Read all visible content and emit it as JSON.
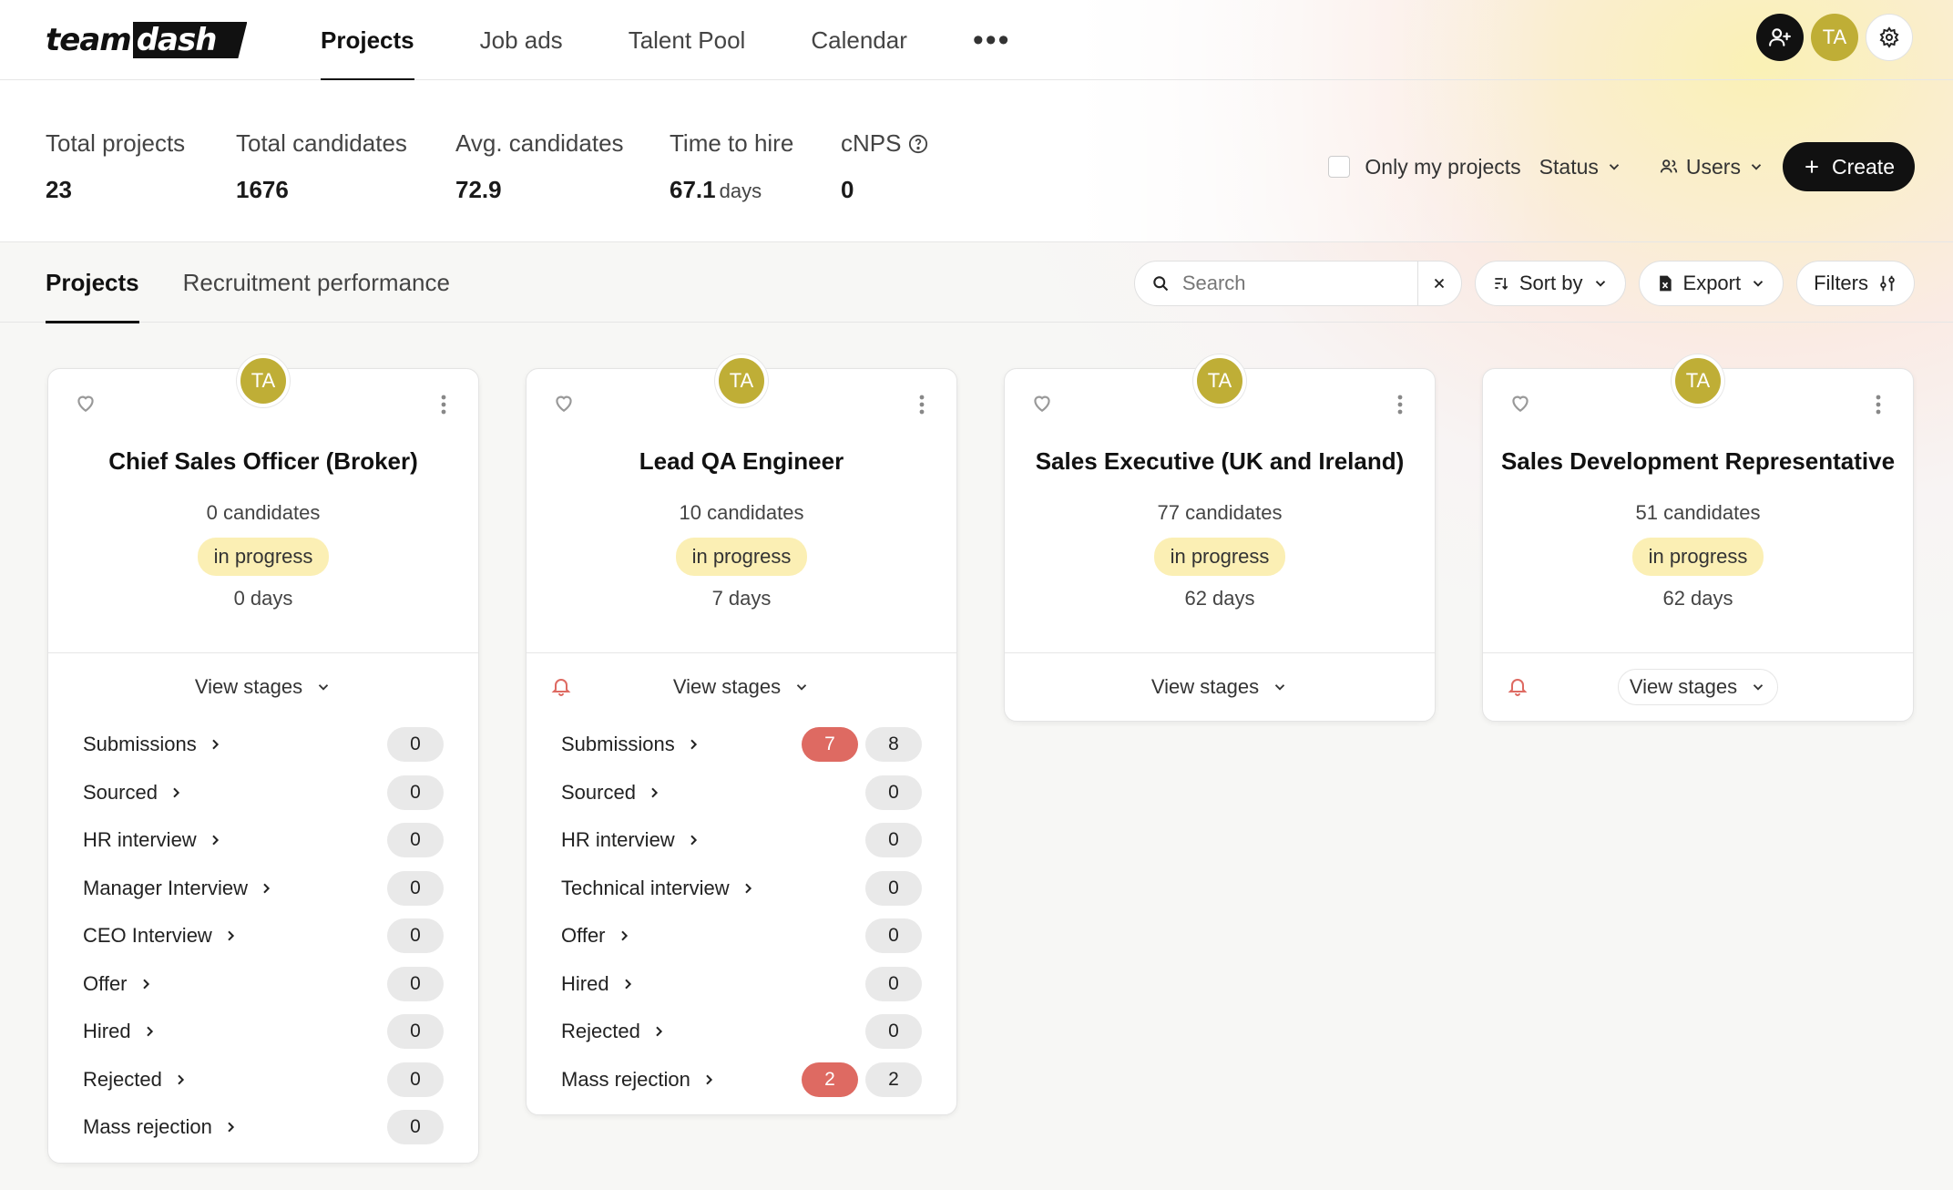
{
  "app": {
    "logo_left": "team",
    "logo_right": "dash"
  },
  "nav": [
    {
      "label": "Projects",
      "active": true
    },
    {
      "label": "Job ads",
      "active": false
    },
    {
      "label": "Talent Pool",
      "active": false
    },
    {
      "label": "Calendar",
      "active": false
    }
  ],
  "nav_more": "•••",
  "user": {
    "initials": "TA"
  },
  "stats": [
    {
      "label": "Total projects",
      "value": "23",
      "unit": ""
    },
    {
      "label": "Total candidates",
      "value": "1676",
      "unit": ""
    },
    {
      "label": "Avg. candidates",
      "value": "72.9",
      "unit": ""
    },
    {
      "label": "Time to hire",
      "value": "67.1",
      "unit": "days"
    },
    {
      "label": "cNPS",
      "value": "0",
      "unit": ""
    }
  ],
  "filters": {
    "only_mine": "Only my projects",
    "status": "Status",
    "users": "Users",
    "create": "Create"
  },
  "subtabs": [
    {
      "label": "Projects",
      "active": true
    },
    {
      "label": "Recruitment performance",
      "active": false
    }
  ],
  "toolbar": {
    "search_placeholder": "Search",
    "sort": "Sort by",
    "export": "Export",
    "filters": "Filters"
  },
  "colors": {
    "avatar": "#bfae36",
    "status_bg": "#fbefb4",
    "alert_red": "#de6a62"
  },
  "cards": [
    {
      "title": "Chief Sales Officer (Broker)",
      "candidates": "0 candidates",
      "status": "in progress",
      "days": "0 days",
      "view_stages": "View stages",
      "stages": [
        {
          "name": "Submissions",
          "new": "",
          "count": "0"
        },
        {
          "name": "Sourced",
          "new": "",
          "count": "0"
        },
        {
          "name": "HR interview",
          "new": "",
          "count": "0"
        },
        {
          "name": "Manager Interview",
          "new": "",
          "count": "0"
        },
        {
          "name": "CEO Interview",
          "new": "",
          "count": "0"
        },
        {
          "name": "Offer",
          "new": "",
          "count": "0"
        },
        {
          "name": "Hired",
          "new": "",
          "count": "0"
        },
        {
          "name": "Rejected",
          "new": "",
          "count": "0"
        },
        {
          "name": "Mass rejection",
          "new": "",
          "count": "0"
        }
      ]
    },
    {
      "title": "Lead QA Engineer",
      "candidates": "10 candidates",
      "status": "in progress",
      "days": "7 days",
      "view_stages": "View stages",
      "stages": [
        {
          "name": "Submissions",
          "new": "7",
          "count": "8"
        },
        {
          "name": "Sourced",
          "new": "",
          "count": "0"
        },
        {
          "name": "HR interview",
          "new": "",
          "count": "0"
        },
        {
          "name": "Technical interview",
          "new": "",
          "count": "0"
        },
        {
          "name": "Offer",
          "new": "",
          "count": "0"
        },
        {
          "name": "Hired",
          "new": "",
          "count": "0"
        },
        {
          "name": "Rejected",
          "new": "",
          "count": "0"
        },
        {
          "name": "Mass rejection",
          "new": "2",
          "count": "2"
        }
      ]
    },
    {
      "title": "Sales Executive (UK and Ireland)",
      "candidates": "77 candidates",
      "status": "in progress",
      "days": "62 days",
      "view_stages": "View stages",
      "stages": []
    },
    {
      "title": "Sales Development Representative",
      "candidates": "51 candidates",
      "status": "in progress",
      "days": "62 days",
      "view_stages": "View stages",
      "stages": []
    }
  ]
}
